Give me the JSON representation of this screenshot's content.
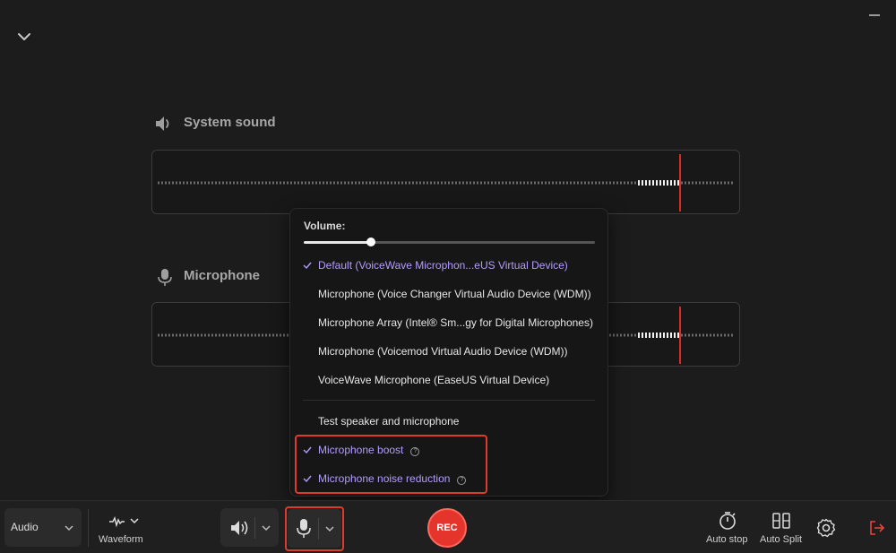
{
  "sections": {
    "system_sound": {
      "title": "System sound",
      "icon": "speaker-icon"
    },
    "microphone": {
      "title": "Microphone",
      "icon": "microphone-icon"
    }
  },
  "volume_menu": {
    "volume_label": "Volume:",
    "volume_level": 0.23,
    "devices": [
      {
        "label": "Default (VoiceWave Microphon...eUS Virtual Device)",
        "checked": true
      },
      {
        "label": "Microphone (Voice Changer Virtual Audio Device (WDM))",
        "checked": false
      },
      {
        "label": "Microphone Array (Intel® Sm...gy for Digital Microphones)",
        "checked": false
      },
      {
        "label": "Microphone (Voicemod Virtual Audio Device (WDM))",
        "checked": false
      },
      {
        "label": "VoiceWave Microphone (EaseUS Virtual Device)",
        "checked": false
      }
    ],
    "test_label": "Test speaker and microphone",
    "options": [
      {
        "label": "Microphone boost",
        "checked": true,
        "icon": "info-icon"
      },
      {
        "label": "Microphone noise reduction",
        "checked": true,
        "icon": "info-icon"
      }
    ]
  },
  "toolbar": {
    "mode": "Audio",
    "waveform_label": "Waveform",
    "rec_label": "REC",
    "auto_stop_label": "Auto stop",
    "auto_split_label": "Auto Split"
  },
  "colors": {
    "accent_purple": "#b49cff",
    "highlight_red": "#e0392f",
    "rec_red": "#e5342c",
    "playhead_red": "#d92b24"
  }
}
